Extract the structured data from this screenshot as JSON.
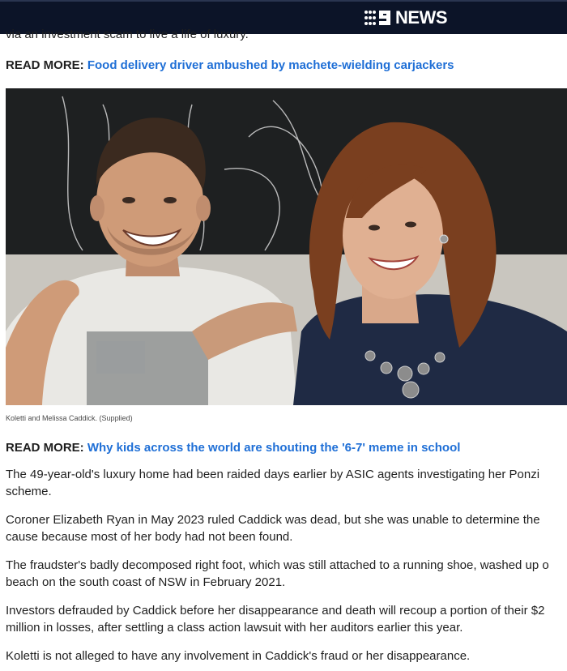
{
  "header": {
    "logo_text": "NEWS",
    "logo_icon": "nine-dots-logo-icon",
    "background": "#0c1428"
  },
  "article": {
    "cut_line": "via an investment scam to live a life of luxury.",
    "read_more_1": {
      "label": "READ MORE:",
      "link": "Food delivery driver ambushed by machete-wielding carjackers"
    },
    "photo": {
      "caption": "Koletti and Melissa Caddick. (Supplied)"
    },
    "read_more_2": {
      "label": "READ MORE:",
      "link": "Why kids across the world are shouting the '6-7' meme in school"
    },
    "paragraphs": [
      "The 49-year-old's luxury home had been raided days earlier by ASIC agents investigating her Ponzi\nscheme.",
      "Coroner Elizabeth Ryan in May 2023 ruled Caddick was dead, but she was unable to determine the\ncause because most of her body had not been found.",
      "The fraudster's badly decomposed right foot, which was still attached to a running shoe, washed up o\nbeach on the south coast of NSW in February 2021.",
      "Investors defrauded by Caddick before her disappearance and death will recoup a portion of their $2\nmillion in losses, after settling a class action lawsuit with her auditors earlier this year.",
      "Koletti is not alleged to have any involvement in Caddick's fraud or her disappearance."
    ]
  },
  "colors": {
    "link": "#1f6fd6",
    "text": "#1f1f1f"
  }
}
